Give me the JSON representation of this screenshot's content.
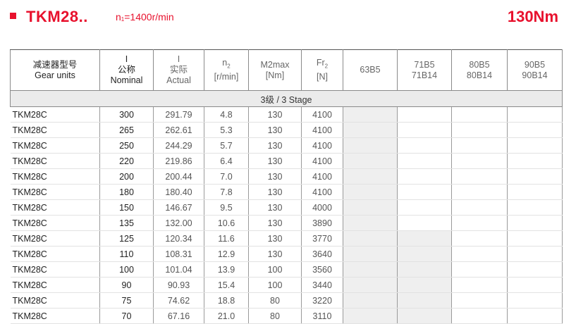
{
  "header": {
    "title": "TKM28..",
    "speed_n": "n",
    "speed_sub": "1",
    "speed_value": "=1400r/min",
    "torque": "130Nm"
  },
  "columns": {
    "model": [
      "减速器型号",
      "Gear units"
    ],
    "nominal": [
      "I",
      "公称",
      "Nominal"
    ],
    "actual": [
      "I",
      "实际",
      "Actual"
    ],
    "n2_base": "n",
    "n2_sub": "2",
    "n2_unit": "[r/min]",
    "m2": [
      "M2max",
      "[Nm]"
    ],
    "fr2_base": "Fr",
    "fr2_sub": "2",
    "fr2_unit": "[N]",
    "m63": [
      "63B5"
    ],
    "m71": [
      "71B5",
      "71B14"
    ],
    "m80": [
      "80B5",
      "80B14"
    ],
    "m90": [
      "90B5",
      "90B14"
    ]
  },
  "stage_label": "3级 / 3 Stage",
  "rows": [
    {
      "model": "TKM28C",
      "nominal": "300",
      "actual": "291.79",
      "n2": "4.8",
      "m2": "130",
      "fr2": "4100",
      "m71": false
    },
    {
      "model": "TKM28C",
      "nominal": "265",
      "actual": "262.61",
      "n2": "5.3",
      "m2": "130",
      "fr2": "4100",
      "m71": false
    },
    {
      "model": "TKM28C",
      "nominal": "250",
      "actual": "244.29",
      "n2": "5.7",
      "m2": "130",
      "fr2": "4100",
      "m71": false
    },
    {
      "model": "TKM28C",
      "nominal": "220",
      "actual": "219.86",
      "n2": "6.4",
      "m2": "130",
      "fr2": "4100",
      "m71": false
    },
    {
      "model": "TKM28C",
      "nominal": "200",
      "actual": "200.44",
      "n2": "7.0",
      "m2": "130",
      "fr2": "4100",
      "m71": false
    },
    {
      "model": "TKM28C",
      "nominal": "180",
      "actual": "180.40",
      "n2": "7.8",
      "m2": "130",
      "fr2": "4100",
      "m71": false
    },
    {
      "model": "TKM28C",
      "nominal": "150",
      "actual": "146.67",
      "n2": "9.5",
      "m2": "130",
      "fr2": "4000",
      "m71": false
    },
    {
      "model": "TKM28C",
      "nominal": "135",
      "actual": "132.00",
      "n2": "10.6",
      "m2": "130",
      "fr2": "3890",
      "m71": false
    },
    {
      "model": "TKM28C",
      "nominal": "125",
      "actual": "120.34",
      "n2": "11.6",
      "m2": "130",
      "fr2": "3770",
      "m71": true
    },
    {
      "model": "TKM28C",
      "nominal": "110",
      "actual": "108.31",
      "n2": "12.9",
      "m2": "130",
      "fr2": "3640",
      "m71": true
    },
    {
      "model": "TKM28C",
      "nominal": "100",
      "actual": "101.04",
      "n2": "13.9",
      "m2": "100",
      "fr2": "3560",
      "m71": true
    },
    {
      "model": "TKM28C",
      "nominal": "90",
      "actual": "90.93",
      "n2": "15.4",
      "m2": "100",
      "fr2": "3440",
      "m71": true
    },
    {
      "model": "TKM28C",
      "nominal": "75",
      "actual": "74.62",
      "n2": "18.8",
      "m2": "80",
      "fr2": "3220",
      "m71": true
    },
    {
      "model": "TKM28C",
      "nominal": "70",
      "actual": "67.16",
      "n2": "21.0",
      "m2": "80",
      "fr2": "3110",
      "m71": true
    }
  ],
  "colors": {
    "accent": "#e8112d",
    "shade": "#efefef",
    "stage_bg": "#ebebeb"
  }
}
